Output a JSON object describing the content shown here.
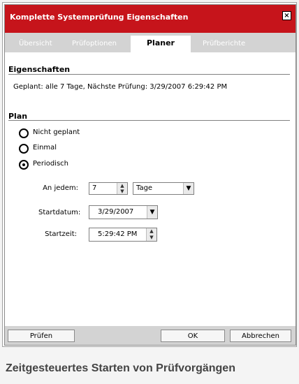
{
  "window": {
    "title": "Komplette Systemprüfung Eigenschaften"
  },
  "tabs": [
    {
      "label": "Übersicht",
      "active": false
    },
    {
      "label": "Prüfoptionen",
      "active": false
    },
    {
      "label": "Planer",
      "active": true
    },
    {
      "label": "Prüfberichte",
      "active": false
    }
  ],
  "eigenschaften": {
    "title": "Eigenschaften",
    "text": "Geplant: alle 7 Tage, Nächste Prüfung: 3/29/2007 6:29:42 PM"
  },
  "plan": {
    "title": "Plan",
    "options": [
      {
        "label": "Nicht geplant",
        "selected": false
      },
      {
        "label": "Einmal",
        "selected": false
      },
      {
        "label": "Periodisch",
        "selected": true
      }
    ],
    "an_jedem_label": "An jedem:",
    "an_jedem_value": "7",
    "unit_value": "Tage",
    "startdatum_label": "Startdatum:",
    "startdatum_value": "3/29/2007",
    "startzeit_label": "Startzeit:",
    "startzeit_value": "5:29:42 PM"
  },
  "footer": {
    "pruefen": "Prüfen",
    "ok": "OK",
    "abbrechen": "Abbrechen"
  },
  "caption": "Zeitgesteuertes Starten von Prüfvorgängen",
  "colors": {
    "titlebar": "#c6141b",
    "window_bg": "#d3d3d3",
    "panel_bg": "#ffffff"
  },
  "icons": {
    "close": "close-icon",
    "spin_up": "spin-up-icon",
    "spin_down": "spin-down-icon",
    "dropdown": "chevron-down-icon"
  }
}
